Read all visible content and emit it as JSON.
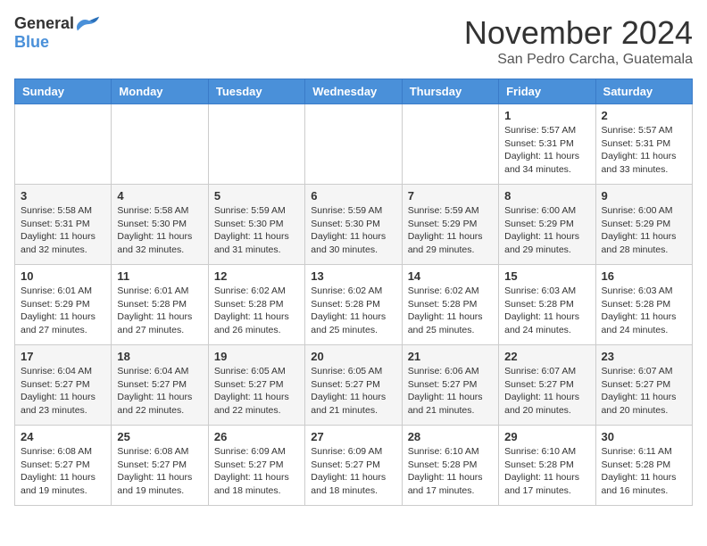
{
  "header": {
    "logo_general": "General",
    "logo_blue": "Blue",
    "month_title": "November 2024",
    "location": "San Pedro Carcha, Guatemala"
  },
  "weekdays": [
    "Sunday",
    "Monday",
    "Tuesday",
    "Wednesday",
    "Thursday",
    "Friday",
    "Saturday"
  ],
  "weeks": [
    [
      {
        "day": "",
        "sunrise": "",
        "sunset": "",
        "daylight": ""
      },
      {
        "day": "",
        "sunrise": "",
        "sunset": "",
        "daylight": ""
      },
      {
        "day": "",
        "sunrise": "",
        "sunset": "",
        "daylight": ""
      },
      {
        "day": "",
        "sunrise": "",
        "sunset": "",
        "daylight": ""
      },
      {
        "day": "",
        "sunrise": "",
        "sunset": "",
        "daylight": ""
      },
      {
        "day": "1",
        "sunrise": "Sunrise: 5:57 AM",
        "sunset": "Sunset: 5:31 PM",
        "daylight": "Daylight: 11 hours and 34 minutes."
      },
      {
        "day": "2",
        "sunrise": "Sunrise: 5:57 AM",
        "sunset": "Sunset: 5:31 PM",
        "daylight": "Daylight: 11 hours and 33 minutes."
      }
    ],
    [
      {
        "day": "3",
        "sunrise": "Sunrise: 5:58 AM",
        "sunset": "Sunset: 5:31 PM",
        "daylight": "Daylight: 11 hours and 32 minutes."
      },
      {
        "day": "4",
        "sunrise": "Sunrise: 5:58 AM",
        "sunset": "Sunset: 5:30 PM",
        "daylight": "Daylight: 11 hours and 32 minutes."
      },
      {
        "day": "5",
        "sunrise": "Sunrise: 5:59 AM",
        "sunset": "Sunset: 5:30 PM",
        "daylight": "Daylight: 11 hours and 31 minutes."
      },
      {
        "day": "6",
        "sunrise": "Sunrise: 5:59 AM",
        "sunset": "Sunset: 5:30 PM",
        "daylight": "Daylight: 11 hours and 30 minutes."
      },
      {
        "day": "7",
        "sunrise": "Sunrise: 5:59 AM",
        "sunset": "Sunset: 5:29 PM",
        "daylight": "Daylight: 11 hours and 29 minutes."
      },
      {
        "day": "8",
        "sunrise": "Sunrise: 6:00 AM",
        "sunset": "Sunset: 5:29 PM",
        "daylight": "Daylight: 11 hours and 29 minutes."
      },
      {
        "day": "9",
        "sunrise": "Sunrise: 6:00 AM",
        "sunset": "Sunset: 5:29 PM",
        "daylight": "Daylight: 11 hours and 28 minutes."
      }
    ],
    [
      {
        "day": "10",
        "sunrise": "Sunrise: 6:01 AM",
        "sunset": "Sunset: 5:29 PM",
        "daylight": "Daylight: 11 hours and 27 minutes."
      },
      {
        "day": "11",
        "sunrise": "Sunrise: 6:01 AM",
        "sunset": "Sunset: 5:28 PM",
        "daylight": "Daylight: 11 hours and 27 minutes."
      },
      {
        "day": "12",
        "sunrise": "Sunrise: 6:02 AM",
        "sunset": "Sunset: 5:28 PM",
        "daylight": "Daylight: 11 hours and 26 minutes."
      },
      {
        "day": "13",
        "sunrise": "Sunrise: 6:02 AM",
        "sunset": "Sunset: 5:28 PM",
        "daylight": "Daylight: 11 hours and 25 minutes."
      },
      {
        "day": "14",
        "sunrise": "Sunrise: 6:02 AM",
        "sunset": "Sunset: 5:28 PM",
        "daylight": "Daylight: 11 hours and 25 minutes."
      },
      {
        "day": "15",
        "sunrise": "Sunrise: 6:03 AM",
        "sunset": "Sunset: 5:28 PM",
        "daylight": "Daylight: 11 hours and 24 minutes."
      },
      {
        "day": "16",
        "sunrise": "Sunrise: 6:03 AM",
        "sunset": "Sunset: 5:28 PM",
        "daylight": "Daylight: 11 hours and 24 minutes."
      }
    ],
    [
      {
        "day": "17",
        "sunrise": "Sunrise: 6:04 AM",
        "sunset": "Sunset: 5:27 PM",
        "daylight": "Daylight: 11 hours and 23 minutes."
      },
      {
        "day": "18",
        "sunrise": "Sunrise: 6:04 AM",
        "sunset": "Sunset: 5:27 PM",
        "daylight": "Daylight: 11 hours and 22 minutes."
      },
      {
        "day": "19",
        "sunrise": "Sunrise: 6:05 AM",
        "sunset": "Sunset: 5:27 PM",
        "daylight": "Daylight: 11 hours and 22 minutes."
      },
      {
        "day": "20",
        "sunrise": "Sunrise: 6:05 AM",
        "sunset": "Sunset: 5:27 PM",
        "daylight": "Daylight: 11 hours and 21 minutes."
      },
      {
        "day": "21",
        "sunrise": "Sunrise: 6:06 AM",
        "sunset": "Sunset: 5:27 PM",
        "daylight": "Daylight: 11 hours and 21 minutes."
      },
      {
        "day": "22",
        "sunrise": "Sunrise: 6:07 AM",
        "sunset": "Sunset: 5:27 PM",
        "daylight": "Daylight: 11 hours and 20 minutes."
      },
      {
        "day": "23",
        "sunrise": "Sunrise: 6:07 AM",
        "sunset": "Sunset: 5:27 PM",
        "daylight": "Daylight: 11 hours and 20 minutes."
      }
    ],
    [
      {
        "day": "24",
        "sunrise": "Sunrise: 6:08 AM",
        "sunset": "Sunset: 5:27 PM",
        "daylight": "Daylight: 11 hours and 19 minutes."
      },
      {
        "day": "25",
        "sunrise": "Sunrise: 6:08 AM",
        "sunset": "Sunset: 5:27 PM",
        "daylight": "Daylight: 11 hours and 19 minutes."
      },
      {
        "day": "26",
        "sunrise": "Sunrise: 6:09 AM",
        "sunset": "Sunset: 5:27 PM",
        "daylight": "Daylight: 11 hours and 18 minutes."
      },
      {
        "day": "27",
        "sunrise": "Sunrise: 6:09 AM",
        "sunset": "Sunset: 5:27 PM",
        "daylight": "Daylight: 11 hours and 18 minutes."
      },
      {
        "day": "28",
        "sunrise": "Sunrise: 6:10 AM",
        "sunset": "Sunset: 5:28 PM",
        "daylight": "Daylight: 11 hours and 17 minutes."
      },
      {
        "day": "29",
        "sunrise": "Sunrise: 6:10 AM",
        "sunset": "Sunset: 5:28 PM",
        "daylight": "Daylight: 11 hours and 17 minutes."
      },
      {
        "day": "30",
        "sunrise": "Sunrise: 6:11 AM",
        "sunset": "Sunset: 5:28 PM",
        "daylight": "Daylight: 11 hours and 16 minutes."
      }
    ]
  ]
}
